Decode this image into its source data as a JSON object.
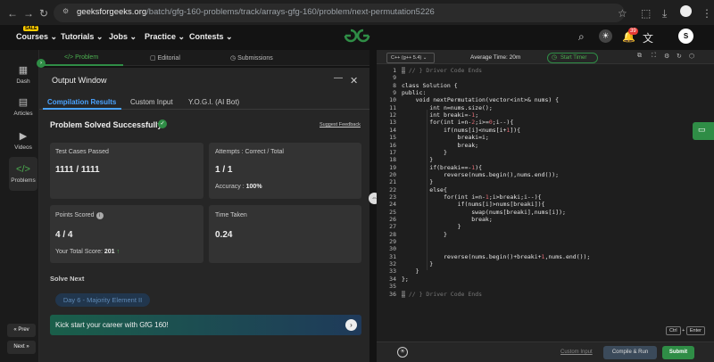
{
  "browser": {
    "url_domain": "geeksforgeeks.org",
    "url_path": "/batch/gfg-160-problems/track/arrays-gfg-160/problem/next-permutation5226"
  },
  "nav": {
    "sale_badge": "SALE",
    "items": [
      "Courses",
      "Tutorials",
      "Jobs",
      "Practice",
      "Contests"
    ],
    "logo_text": "GfG",
    "notification_count": "39",
    "avatar_initial": "S"
  },
  "sidebar": {
    "items": [
      "Dash",
      "Articles",
      "Videos",
      "Problems"
    ],
    "prev": "Prev",
    "next": "Next"
  },
  "problem_tabs": [
    "Problem",
    "Editorial",
    "Submissions"
  ],
  "output": {
    "title": "Output Window",
    "tabs": [
      "Compilation Results",
      "Custom Input",
      "Y.O.G.I. (AI Bot)"
    ],
    "status": "Problem Solved Successfully",
    "suggest": "Suggest Feedback",
    "test_cases_label": "Test Cases Passed",
    "test_cases_value": "1111 / 1111",
    "attempts_label": "Attempts : Correct / Total",
    "attempts_value": "1 / 1",
    "accuracy_label": "Accuracy :",
    "accuracy_value": "100%",
    "points_label": "Points Scored",
    "points_value": "4 / 4",
    "total_score_label": "Your Total Score:",
    "total_score_value": "201",
    "time_label": "Time Taken",
    "time_value": "0.24",
    "solve_next": "Solve Next",
    "next_problem": "Day 6 - Majority Element II",
    "banner": "Kick start your career with GfG 160!"
  },
  "editor": {
    "language": "C++ (g++ 5.4)",
    "avg_time": "Average Time: 20m",
    "timer": "Start Timer",
    "lines": [
      {
        "n": "1",
        "t": "// } Driver Code Ends"
      },
      {
        "n": "9",
        "t": ""
      },
      {
        "n": "8",
        "t": "class Solution {"
      },
      {
        "n": "9",
        "t": "public:"
      },
      {
        "n": "10",
        "t": "    void nextPermutation(vector<int>& nums) {"
      },
      {
        "n": "11",
        "t": "        int n=nums.size();"
      },
      {
        "n": "12",
        "t": "        int breaki=-1;"
      },
      {
        "n": "13",
        "t": "        for(int i=n-2;i>=0;i--){"
      },
      {
        "n": "14",
        "t": "            if(nums[i]<nums[i+1]){"
      },
      {
        "n": "15",
        "t": "                breaki=i;"
      },
      {
        "n": "16",
        "t": "                break;"
      },
      {
        "n": "17",
        "t": "            }"
      },
      {
        "n": "18",
        "t": "        }"
      },
      {
        "n": "19",
        "t": "        if(breaki==-1){"
      },
      {
        "n": "20",
        "t": "            reverse(nums.begin(),nums.end());"
      },
      {
        "n": "21",
        "t": "        }"
      },
      {
        "n": "22",
        "t": "        else{"
      },
      {
        "n": "23",
        "t": "            for(int i=n-1;i>breaki;i--){"
      },
      {
        "n": "24",
        "t": "                if(nums[i]>nums[breaki]){"
      },
      {
        "n": "25",
        "t": "                    swap(nums[breaki],nums[i]);"
      },
      {
        "n": "26",
        "t": "                    break;"
      },
      {
        "n": "27",
        "t": "                }"
      },
      {
        "n": "28",
        "t": "            }"
      },
      {
        "n": "29",
        "t": ""
      },
      {
        "n": "30",
        "t": ""
      },
      {
        "n": "31",
        "t": "            reverse(nums.begin()+breaki+1,nums.end());"
      },
      {
        "n": "32",
        "t": "        }"
      },
      {
        "n": "33",
        "t": "    }"
      },
      {
        "n": "34",
        "t": "};"
      },
      {
        "n": "35",
        "t": ""
      },
      {
        "n": "36",
        "t": "// } Driver Code Ends"
      }
    ],
    "shortcut_ctrl": "Ctrl",
    "shortcut_plus": "+",
    "shortcut_enter": "Enter",
    "custom_input": "Custom Input",
    "compile_run": "Compile & Run",
    "submit": "Submit"
  },
  "colors": {
    "accent": "#2f8d46",
    "tab_active": "#4aa3ff"
  }
}
